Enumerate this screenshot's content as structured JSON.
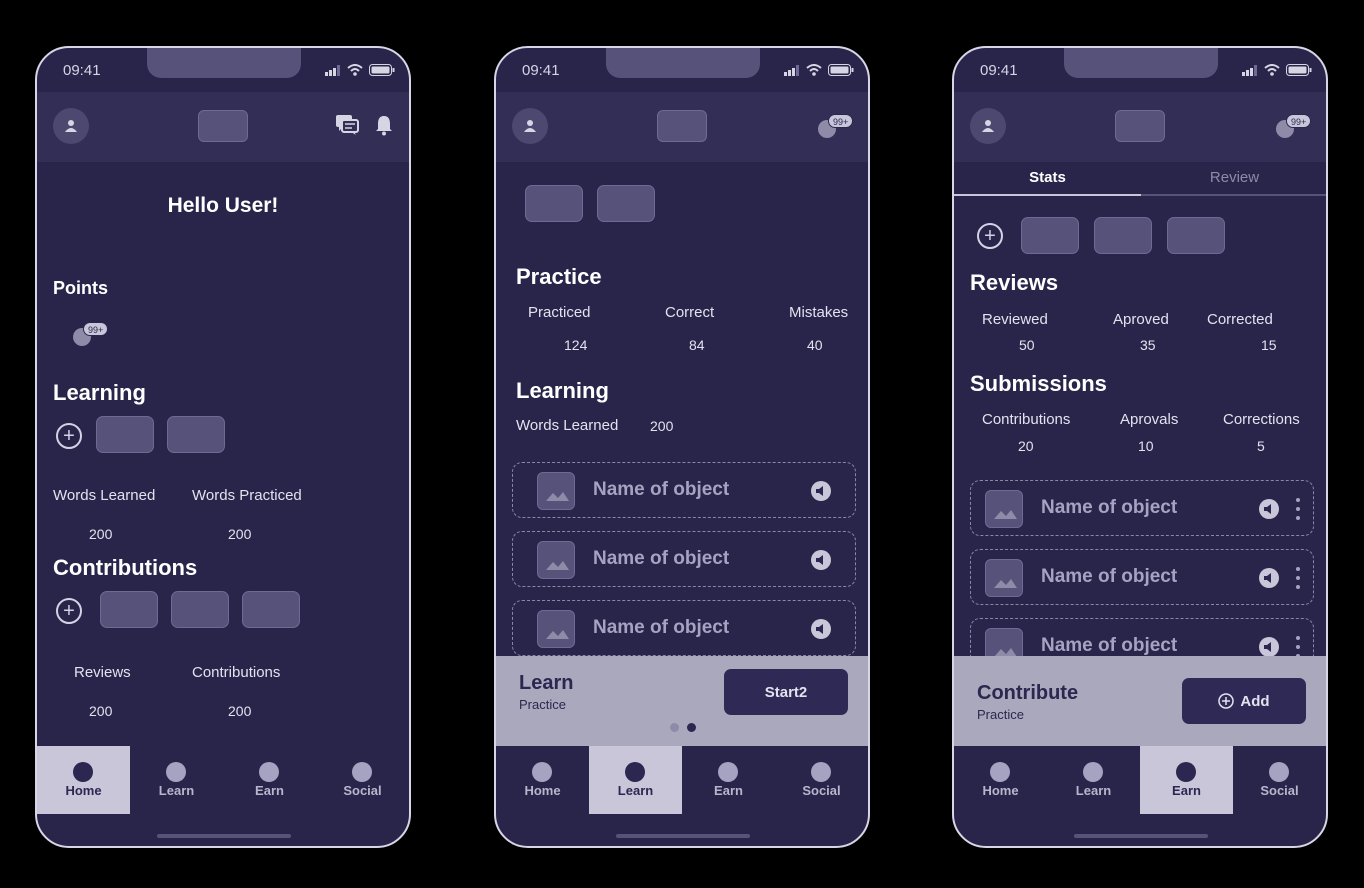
{
  "status": {
    "time": "09:41"
  },
  "badge": "99+",
  "tabs": [
    "Home",
    "Learn",
    "Earn",
    "Social"
  ],
  "home": {
    "greeting": "Hello User!",
    "points_title": "Points",
    "learning_title": "Learning",
    "words_learned_label": "Words Learned",
    "words_practiced_label": "Words Practiced",
    "words_learned_value": "200",
    "words_practiced_value": "200",
    "contributions_title": "Contributions",
    "reviews_label": "Reviews",
    "contributions_label": "Contributions",
    "reviews_value": "200",
    "contributions_value": "200",
    "active_tab": "Home"
  },
  "learn": {
    "practice_title": "Practice",
    "stats": [
      {
        "label": "Practiced",
        "value": "124"
      },
      {
        "label": "Correct",
        "value": "84"
      },
      {
        "label": "Mistakes",
        "value": "40"
      }
    ],
    "learning_title": "Learning",
    "words_learned_label": "Words Learned",
    "words_learned_value": "200",
    "objects": [
      "Name of object",
      "Name of object",
      "Name of object"
    ],
    "cta_title": "Learn",
    "cta_subtitle": "Practice",
    "cta_button": "Start2",
    "active_tab": "Learn"
  },
  "earn": {
    "segment_tabs": [
      "Stats",
      "Review"
    ],
    "reviews_title": "Reviews",
    "review_stats": [
      {
        "label": "Reviewed",
        "value": "50"
      },
      {
        "label": "Aproved",
        "value": "35"
      },
      {
        "label": "Corrected",
        "value": "15"
      }
    ],
    "submissions_title": "Submissions",
    "submission_stats": [
      {
        "label": "Contributions",
        "value": "20"
      },
      {
        "label": "Aprovals",
        "value": "10"
      },
      {
        "label": "Corrections",
        "value": "5"
      }
    ],
    "objects": [
      "Name of object",
      "Name of object",
      "Name of object"
    ],
    "cta_title": "Contribute",
    "cta_subtitle": "Practice",
    "cta_button": "Add",
    "active_tab": "Earn"
  },
  "colors": {
    "phone_bg": "#29244a",
    "appbar_bg": "#322e56",
    "cta_panel": "#aaa8bc",
    "active_tab_bg": "#c9c6da",
    "accent_dark": "#2b2750"
  },
  "icons": [
    "person-icon",
    "chat-icon",
    "bell-icon",
    "signal-icon",
    "wifi-icon",
    "battery-icon",
    "add-circle-icon",
    "image-icon",
    "speaker-icon",
    "more-vertical-icon"
  ]
}
